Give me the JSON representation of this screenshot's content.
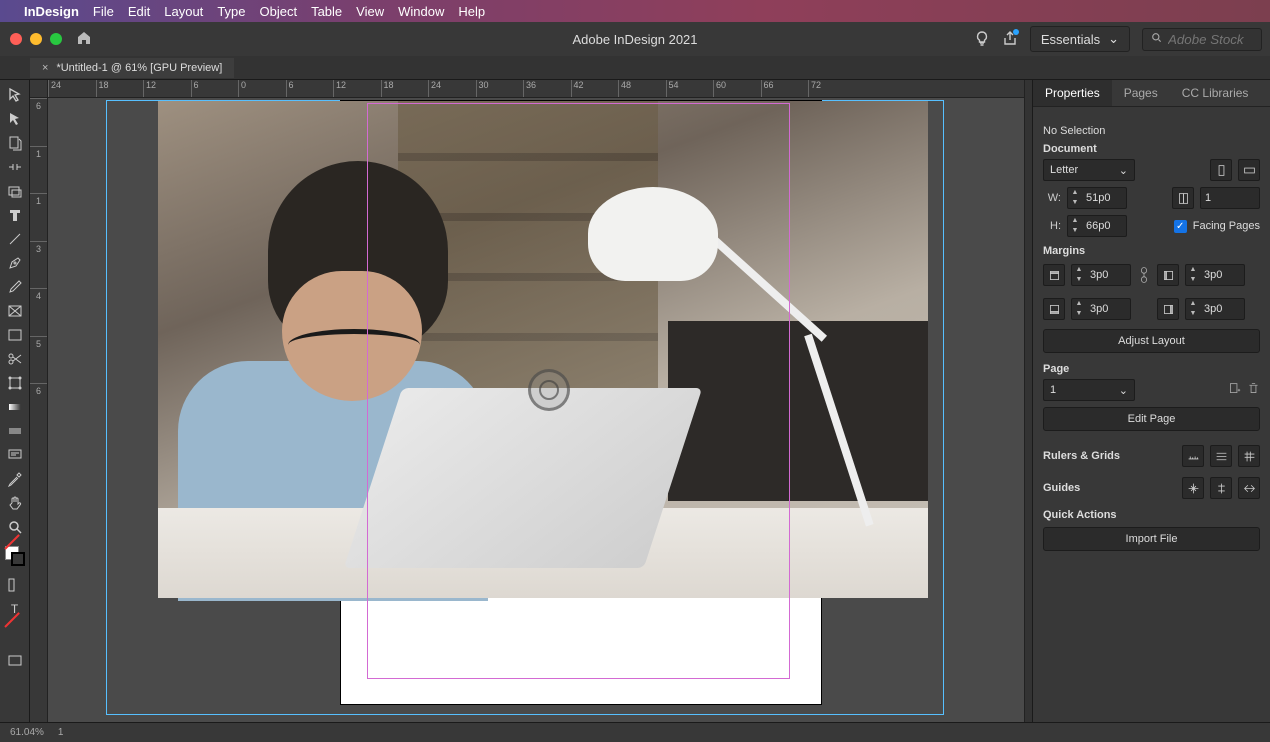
{
  "menubar": {
    "app": "InDesign",
    "items": [
      "File",
      "Edit",
      "Layout",
      "Type",
      "Object",
      "Table",
      "View",
      "Window",
      "Help"
    ]
  },
  "titlebar": {
    "title": "Adobe InDesign 2021",
    "workspace": "Essentials",
    "stock_placeholder": "Adobe Stock"
  },
  "doc_tab": {
    "label": "*Untitled-1 @ 61% [GPU Preview]"
  },
  "ruler_h": [
    "24",
    "18",
    "12",
    "6",
    "0",
    "6",
    "12",
    "18",
    "24",
    "30",
    "36",
    "42",
    "48",
    "54",
    "60",
    "66",
    "72"
  ],
  "ruler_v": [
    "6",
    "1",
    "1",
    "3",
    "4",
    "5",
    "6"
  ],
  "panel": {
    "tabs": [
      "Properties",
      "Pages",
      "CC Libraries"
    ],
    "no_selection": "No Selection",
    "document": "Document",
    "page_size": "Letter",
    "w_label": "W:",
    "h_label": "H:",
    "w": "51p0",
    "h": "66p0",
    "pages_count": "1",
    "facing": "Facing Pages",
    "margins": "Margins",
    "m_top": "3p0",
    "m_bottom": "3p0",
    "m_inside": "3p0",
    "m_outside": "3p0",
    "adjust_layout": "Adjust Layout",
    "page": "Page",
    "page_num": "1",
    "edit_page": "Edit Page",
    "rulers_grids": "Rulers & Grids",
    "guides": "Guides",
    "quick_actions": "Quick Actions",
    "import_file": "Import File"
  },
  "status": {
    "zoom": "61.04%",
    "page": "1"
  }
}
